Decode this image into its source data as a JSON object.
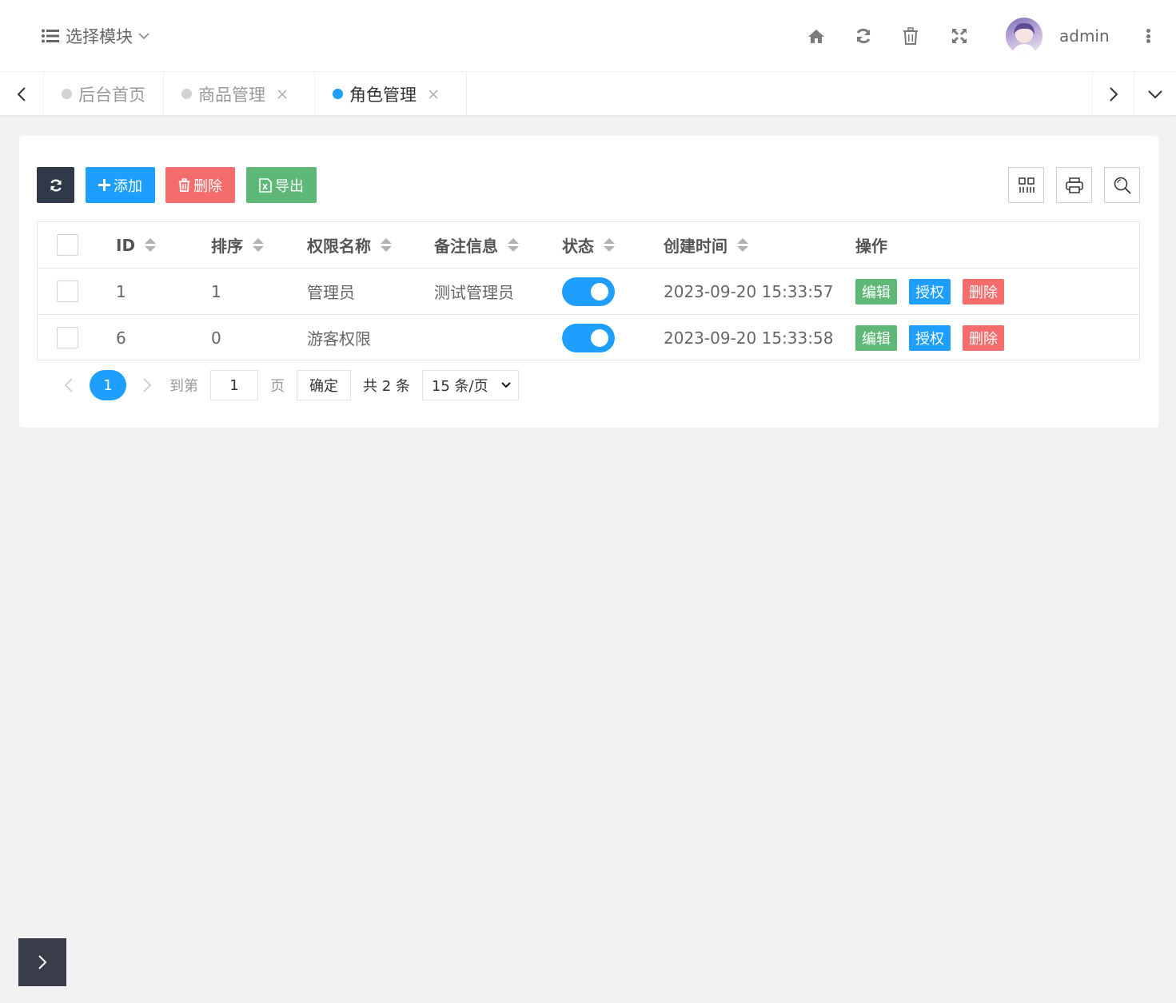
{
  "header": {
    "module_select_label": "选择模块",
    "username": "admin",
    "icons": [
      "home-icon",
      "refresh-icon",
      "trash-icon",
      "fullscreen-icon",
      "more-icon"
    ]
  },
  "tabs": [
    {
      "label": "后台首页",
      "active": false,
      "closable": false
    },
    {
      "label": "商品管理",
      "active": false,
      "closable": true
    },
    {
      "label": "角色管理",
      "active": true,
      "closable": true
    }
  ],
  "toolbar": {
    "add_label": "添加",
    "delete_label": "删除",
    "export_label": "导出"
  },
  "colors": {
    "primary": "#1e9fff",
    "danger": "#f56c6c",
    "success": "#5fb878",
    "dark": "#2f3949",
    "background": "#f2f2f2"
  },
  "table": {
    "columns": [
      "ID",
      "排序",
      "权限名称",
      "备注信息",
      "状态",
      "创建时间",
      "操作"
    ],
    "rows": [
      {
        "id": "1",
        "sort": "1",
        "name": "管理员",
        "remark": "测试管理员",
        "status": true,
        "created": "2023-09-20 15:33:57"
      },
      {
        "id": "6",
        "sort": "0",
        "name": "游客权限",
        "remark": "",
        "status": true,
        "created": "2023-09-20 15:33:58"
      }
    ],
    "actions": {
      "edit": "编辑",
      "auth": "授权",
      "delete": "删除"
    }
  },
  "pagination": {
    "current_page": "1",
    "goto_label": "到第",
    "goto_value": "1",
    "page_label": "页",
    "confirm_label": "确定",
    "total_label": "共 2 条",
    "page_size": "15 条/页"
  }
}
